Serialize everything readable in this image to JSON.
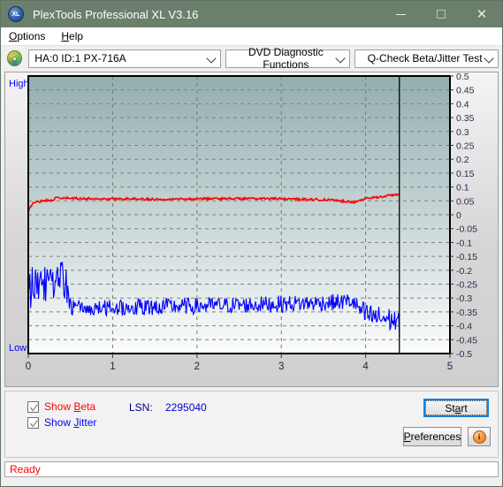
{
  "window": {
    "title": "PlexTools Professional XL V3.16",
    "icon": "xl-app-icon",
    "minimize_label": "minimize",
    "maximize_label": "maximize",
    "close_label": "close"
  },
  "menubar": {
    "items": [
      {
        "label": "Options",
        "accel": "O"
      },
      {
        "label": "Help",
        "accel": "H"
      }
    ]
  },
  "toolbar": {
    "disc_icon": "optical-disc-icon",
    "drive_select": "HA:0 ID:1  PX-716A",
    "function_select": "DVD Diagnostic Functions",
    "test_select": "Q-Check Beta/Jitter Test"
  },
  "graph": {
    "high_label": "High",
    "low_label": "Low"
  },
  "chart_data": {
    "type": "line",
    "title": "Q-Check Beta/Jitter Test",
    "xlabel": "",
    "ylabel": "",
    "xlim": [
      0,
      5
    ],
    "ylim": [
      -0.5,
      0.5
    ],
    "x_ticks": [
      "0",
      "1",
      "2",
      "3",
      "4",
      "5"
    ],
    "x_tick_values": [
      0,
      1,
      2,
      3,
      4,
      5
    ],
    "y_ticks": [
      "0.5",
      "0.45",
      "0.4",
      "0.35",
      "0.3",
      "0.25",
      "0.2",
      "0.15",
      "0.1",
      "0.05",
      "0",
      "-0.05",
      "-0.1",
      "-0.15",
      "-0.2",
      "-0.25",
      "-0.3",
      "-0.35",
      "-0.4",
      "-0.45",
      "-0.5"
    ],
    "y_tick_values": [
      0.5,
      0.45,
      0.4,
      0.35,
      0.3,
      0.25,
      0.2,
      0.15,
      0.1,
      0.05,
      0,
      -0.05,
      -0.1,
      -0.15,
      -0.2,
      -0.25,
      -0.3,
      -0.35,
      -0.4,
      -0.45,
      -0.5
    ],
    "grid": true,
    "grid_style": "dashed",
    "legend": [
      "Show Beta",
      "Show Jitter"
    ],
    "legend_position": "below-left",
    "data_end_x": 4.4,
    "background_gradient": [
      "#93aeb0",
      "#fbfcfc"
    ],
    "series": [
      {
        "name": "Beta",
        "color": "#ff0000",
        "x": [
          0.0,
          0.05,
          0.1,
          0.15,
          0.2,
          0.25,
          0.3,
          0.35,
          0.4,
          0.45,
          0.5,
          0.6,
          0.7,
          0.8,
          0.9,
          1.0,
          1.1,
          1.2,
          1.3,
          1.4,
          1.5,
          1.6,
          1.7,
          1.8,
          1.9,
          2.0,
          2.1,
          2.2,
          2.3,
          2.4,
          2.5,
          2.6,
          2.7,
          2.8,
          2.9,
          3.0,
          3.1,
          3.2,
          3.3,
          3.4,
          3.5,
          3.6,
          3.7,
          3.8,
          3.85,
          3.9,
          3.95,
          4.0,
          4.1,
          4.2,
          4.3,
          4.4
        ],
        "y": [
          0.01,
          0.042,
          0.046,
          0.049,
          0.053,
          0.05,
          0.056,
          0.062,
          0.058,
          0.06,
          0.059,
          0.059,
          0.058,
          0.058,
          0.057,
          0.057,
          0.058,
          0.058,
          0.057,
          0.057,
          0.056,
          0.056,
          0.057,
          0.057,
          0.057,
          0.057,
          0.058,
          0.058,
          0.058,
          0.059,
          0.058,
          0.058,
          0.058,
          0.058,
          0.058,
          0.057,
          0.057,
          0.056,
          0.056,
          0.055,
          0.054,
          0.053,
          0.05,
          0.048,
          0.045,
          0.05,
          0.054,
          0.058,
          0.062,
          0.066,
          0.07,
          0.074
        ],
        "noise": 0.004
      },
      {
        "name": "Jitter",
        "color": "#0000ff",
        "x": [
          0.0,
          0.03,
          0.06,
          0.09,
          0.12,
          0.15,
          0.18,
          0.21,
          0.24,
          0.27,
          0.3,
          0.33,
          0.36,
          0.39,
          0.42,
          0.45,
          0.48,
          0.5,
          0.55,
          0.6,
          0.7,
          0.8,
          0.9,
          1.0,
          1.1,
          1.2,
          1.3,
          1.4,
          1.5,
          1.6,
          1.7,
          1.8,
          1.9,
          2.0,
          2.1,
          2.2,
          2.3,
          2.4,
          2.5,
          2.6,
          2.7,
          2.8,
          2.9,
          3.0,
          3.1,
          3.2,
          3.3,
          3.4,
          3.5,
          3.6,
          3.7,
          3.75,
          3.8,
          3.85,
          3.9,
          3.95,
          4.0,
          4.1,
          4.2,
          4.3,
          4.35,
          4.4
        ],
        "y": [
          -0.3,
          -0.27,
          -0.24,
          -0.255,
          -0.235,
          -0.245,
          -0.255,
          -0.24,
          -0.25,
          -0.265,
          -0.25,
          -0.245,
          -0.255,
          -0.225,
          -0.24,
          -0.26,
          -0.3,
          -0.33,
          -0.335,
          -0.338,
          -0.338,
          -0.337,
          -0.336,
          -0.335,
          -0.334,
          -0.333,
          -0.333,
          -0.332,
          -0.331,
          -0.331,
          -0.33,
          -0.33,
          -0.329,
          -0.329,
          -0.328,
          -0.327,
          -0.327,
          -0.326,
          -0.326,
          -0.325,
          -0.324,
          -0.323,
          -0.322,
          -0.321,
          -0.32,
          -0.32,
          -0.319,
          -0.318,
          -0.317,
          -0.316,
          -0.315,
          -0.313,
          -0.31,
          -0.315,
          -0.33,
          -0.35,
          -0.362,
          -0.368,
          -0.372,
          -0.378,
          -0.382,
          -0.4
        ],
        "noise": 0.03
      }
    ]
  },
  "controls": {
    "show_beta": {
      "label_pre": "Show ",
      "label_accel": "B",
      "label_post": "eta",
      "checked": true
    },
    "show_jitter": {
      "label_pre": "Show ",
      "label_accel": "J",
      "label_post": "itter",
      "checked": true
    },
    "lsn_label": "LSN:",
    "lsn_value": "2295040",
    "start_label_pre": "St",
    "start_label_accel": "a",
    "start_label_post": "rt",
    "preferences_label_pre": "",
    "preferences_label_accel": "P",
    "preferences_label_post": "references",
    "info_icon": "info-icon",
    "info_glyph": "i"
  },
  "statusbar": {
    "text": "Ready"
  }
}
